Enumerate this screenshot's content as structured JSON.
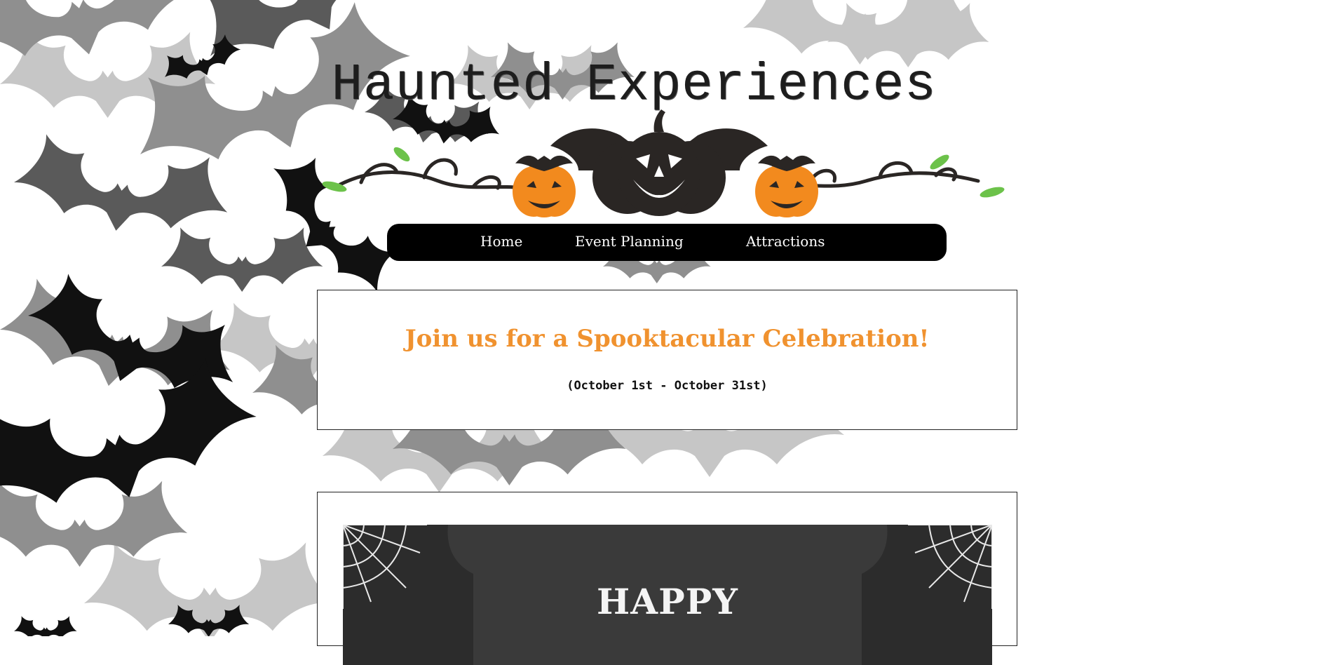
{
  "site": {
    "title": "Haunted Experiences",
    "logo_icon": "pumpkin-bat-banner"
  },
  "nav": {
    "items": [
      {
        "label": "Home"
      },
      {
        "label": "Event Planning"
      },
      {
        "label": "Attractions"
      }
    ]
  },
  "hero": {
    "headline": "Join us for a Spooktacular Celebration!",
    "dates": "(October 1st - October 31st)"
  },
  "poster": {
    "text": "HAPPY"
  },
  "colors": {
    "accent_orange": "#f0922f",
    "nav_bg": "#000000",
    "bat_dark": "#111111",
    "bat_mid": "#5a5a5a",
    "bat_light": "#b5b5b5",
    "chalkboard": "#2c2c2c",
    "leaf_green": "#6cc24a"
  }
}
